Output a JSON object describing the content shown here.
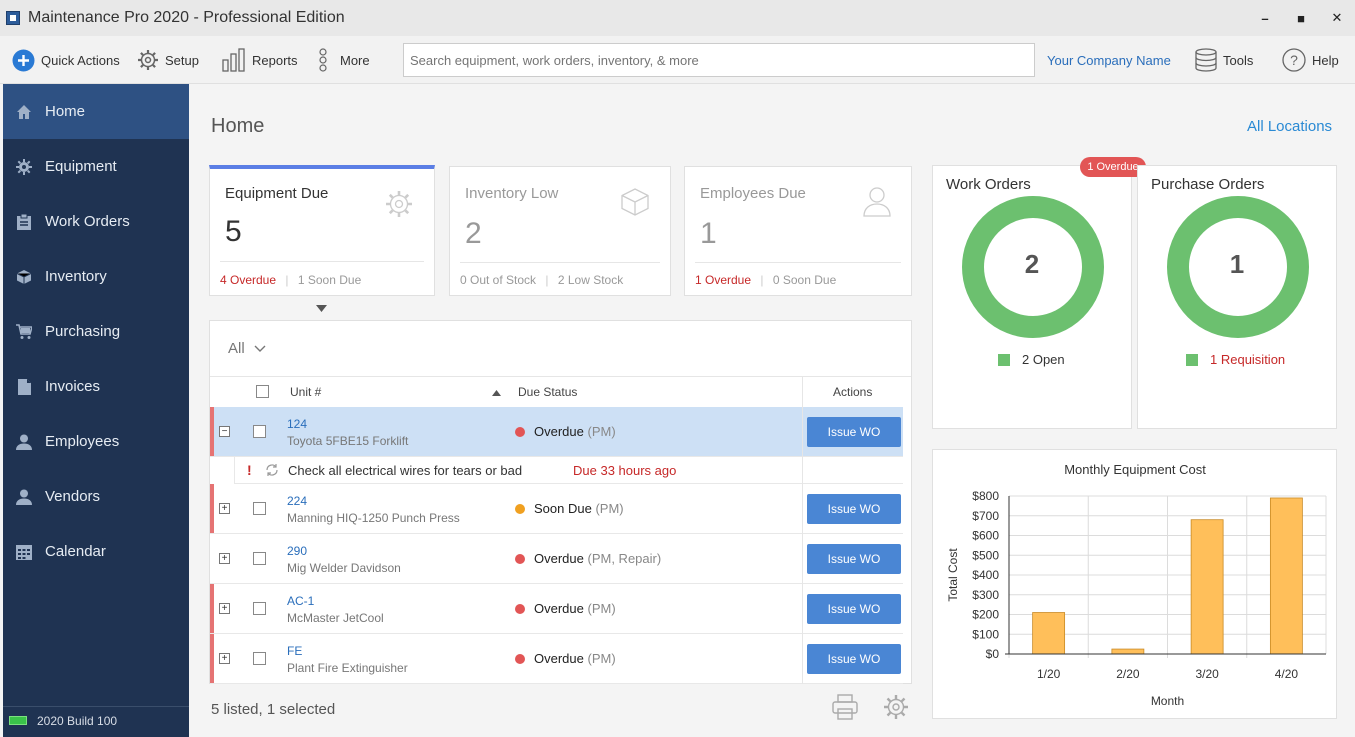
{
  "window": {
    "title": "Maintenance Pro 2020 -  Professional Edition",
    "minimize": "–",
    "maximize": "■",
    "close": "✕"
  },
  "toolbar": {
    "quick_actions": "Quick Actions",
    "setup": "Setup",
    "reports": "Reports",
    "more": "More",
    "search_placeholder": "Search equipment, work orders, inventory, & more",
    "company": "Your Company Name",
    "tools": "Tools",
    "help": "Help"
  },
  "sidebar": {
    "items": [
      {
        "label": "Home",
        "icon": "home-icon"
      },
      {
        "label": "Equipment",
        "icon": "gear-icon"
      },
      {
        "label": "Work Orders",
        "icon": "clipboard-icon"
      },
      {
        "label": "Inventory",
        "icon": "box-icon"
      },
      {
        "label": "Purchasing",
        "icon": "cart-icon"
      },
      {
        "label": "Invoices",
        "icon": "document-icon"
      },
      {
        "label": "Employees",
        "icon": "person-icon"
      },
      {
        "label": "Vendors",
        "icon": "person-icon"
      },
      {
        "label": "Calendar",
        "icon": "calendar-icon"
      }
    ],
    "build": "2020 Build 100"
  },
  "main": {
    "title": "Home",
    "all_locations": "All Locations",
    "cards": {
      "equipment": {
        "title": "Equipment Due",
        "count": "5",
        "foot_a": "4 Overdue",
        "sep": "|",
        "foot_b": "1 Soon Due"
      },
      "inventory": {
        "title": "Inventory Low",
        "count": "2",
        "foot_a": "0 Out of Stock",
        "sep": "|",
        "foot_b": "2 Low Stock"
      },
      "employees": {
        "title": "Employees Due",
        "count": "1",
        "foot_a": "1 Overdue",
        "sep": "|",
        "foot_b": "0 Soon Due"
      }
    },
    "list": {
      "filter": "All",
      "headers": {
        "unit": "Unit #",
        "due": "Due Status",
        "actions": "Actions"
      },
      "rows": [
        {
          "unit": "124",
          "desc": "Toyota 5FBE15 Forklift",
          "status": "Overdue",
          "sub": "(PM)",
          "action": "Issue WO",
          "expand": "−"
        },
        {
          "unit": "224",
          "desc": "Manning HIQ-1250 Punch Press",
          "status": "Soon Due",
          "sub": "(PM)",
          "action": "Issue WO",
          "expand": "+"
        },
        {
          "unit": "290",
          "desc": "Mig Welder Davidson",
          "status": "Overdue",
          "sub": "(PM, Repair)",
          "action": "Issue WO",
          "expand": "+"
        },
        {
          "unit": "AC-1",
          "desc": "McMaster JetCool",
          "status": "Overdue",
          "sub": "(PM)",
          "action": "Issue WO",
          "expand": "+"
        },
        {
          "unit": "FE",
          "desc": "Plant Fire Extinguisher",
          "status": "Overdue",
          "sub": "(PM)",
          "action": "Issue WO",
          "expand": "+"
        }
      ],
      "subtask": {
        "flag": "!",
        "text": "Check all electrical wires for tears or bad",
        "due": "Due 33 hours ago"
      },
      "footer": "5 listed, 1 selected"
    },
    "work_orders": {
      "title": "Work Orders",
      "badge": "1 Overdue",
      "count": "2",
      "legend": "2 Open"
    },
    "purchase_orders": {
      "title": "Purchase Orders",
      "count": "1",
      "legend": "1 Requisition"
    }
  },
  "colors": {
    "accent": "#2e5183",
    "donut": "#6cc06f",
    "bar": "#ffbf5a",
    "overdue": "#e25555",
    "soon": "#f0a020"
  },
  "chart_data": {
    "type": "bar",
    "title": "Monthly Equipment Cost",
    "xlabel": "Month",
    "ylabel": "Total Cost",
    "categories": [
      "1/20",
      "2/20",
      "3/20",
      "4/20"
    ],
    "values": [
      210,
      25,
      680,
      790
    ],
    "ylim": [
      0,
      800
    ],
    "yticks": [
      "$0",
      "$100",
      "$200",
      "$300",
      "$400",
      "$500",
      "$600",
      "$700",
      "$800"
    ],
    "grid": true
  }
}
